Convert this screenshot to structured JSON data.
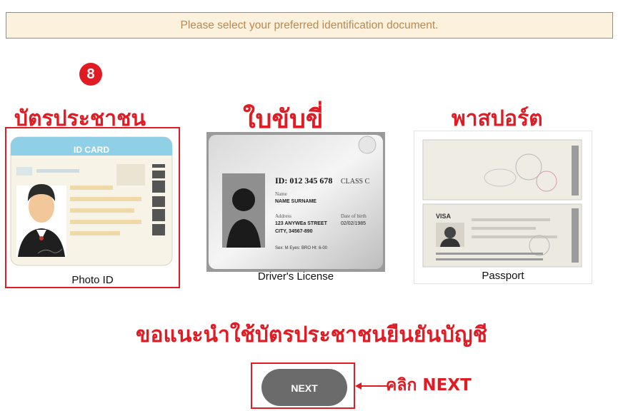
{
  "notice": {
    "text": "Please select your preferred identification document."
  },
  "step_badge": "8",
  "annotations": {
    "photo_id_thai": "บัตรประชาชน",
    "driver_license_thai": "ใบขับขี่",
    "passport_thai": "พาสปอร์ต",
    "advice_thai": "ขอแนะนำใช้บัตรประชาชนยืนยันบัญชี",
    "click_next": "คลิก NEXT"
  },
  "documents": [
    {
      "label": "Photo ID",
      "selected": true,
      "card_header": "ID CARD"
    },
    {
      "label": "Driver's License",
      "selected": false,
      "id_line": "ID: 012 345 678",
      "class_line": "CLASS C",
      "name_label": "Name",
      "name_value": "NAME SURNAME",
      "address_label": "Address",
      "address_line1": "123 ANYWEa STREET",
      "address_line2": "CITY, 34567-890",
      "dob_label": "Date of birth",
      "dob_value": "02/02/1985",
      "footer": "Sex: M   Eyes: BRO   Ht: 6-00"
    },
    {
      "label": "Passport",
      "selected": false,
      "visa_text": "VISA"
    }
  ],
  "next_button": {
    "label": "NEXT"
  },
  "colors": {
    "annotation_red": "#e01b24",
    "notice_bg": "#fcf1dc",
    "notice_text": "#b98a52",
    "button_gray": "#6b6b6b"
  }
}
